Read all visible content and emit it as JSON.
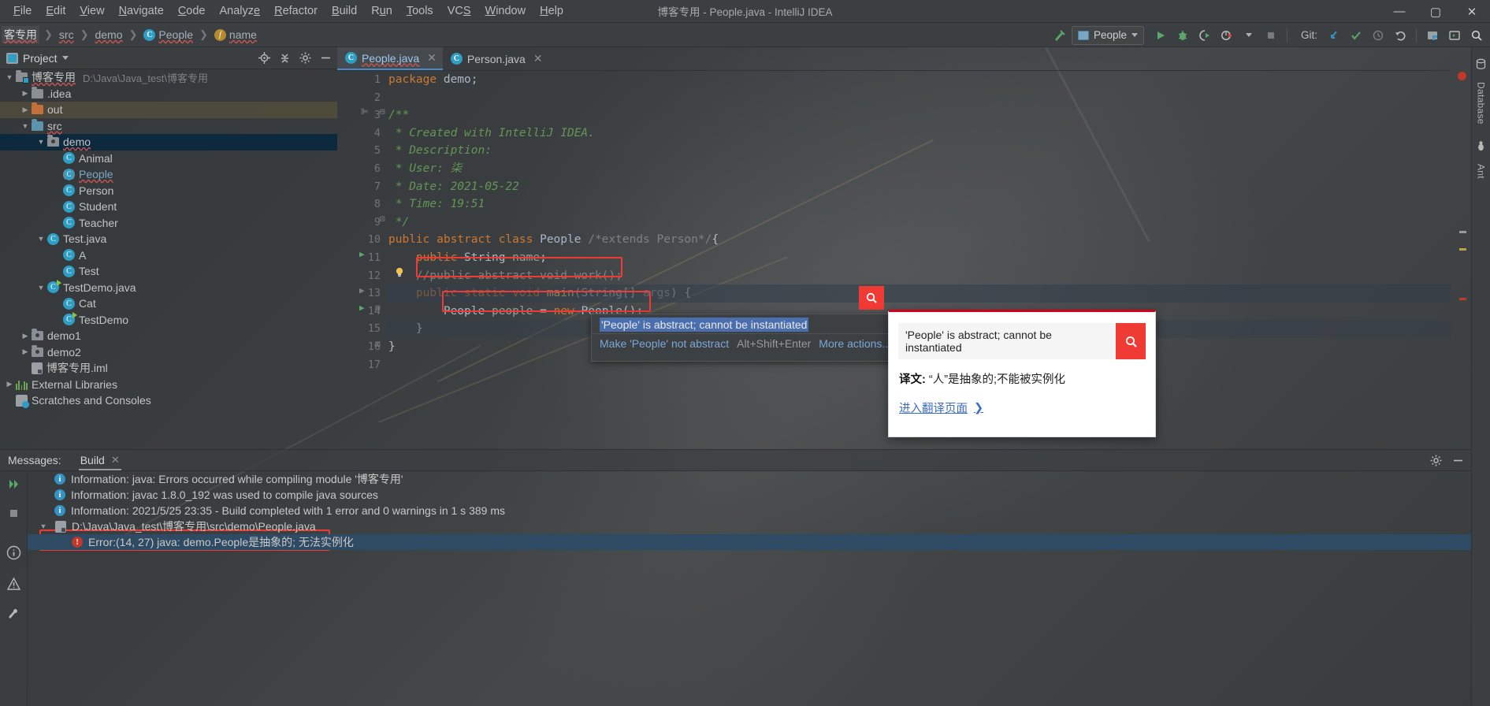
{
  "window": {
    "title": "博客专用 - People.java - IntelliJ IDEA",
    "minimize": "—",
    "maximize": "▢",
    "close": "✕"
  },
  "menubar": {
    "items": [
      "File",
      "Edit",
      "View",
      "Navigate",
      "Code",
      "Analyze",
      "Refactor",
      "Build",
      "Run",
      "Tools",
      "VCS",
      "Window",
      "Help"
    ]
  },
  "breadcrumb": {
    "items": [
      {
        "label": "客专用",
        "icon": ""
      },
      {
        "label": "src",
        "icon": ""
      },
      {
        "label": "demo",
        "icon": ""
      },
      {
        "label": "People",
        "icon": "class-icon",
        "glyph": "C"
      },
      {
        "label": "name",
        "icon": "field-icon",
        "glyph": "f"
      }
    ],
    "separator": "❯"
  },
  "toolbar": {
    "run_config": "People",
    "git_label": "Git:",
    "icons": {
      "build": "hammer-icon",
      "run": "▶",
      "debug": "bug-icon",
      "run_coverage": "coverage-icon",
      "profile": "profiler-icon",
      "stop": "■",
      "update_project": "update-project-icon",
      "commit": "✔",
      "history": "history-icon",
      "rollback": "↺",
      "project_structure": "project-structure-icon",
      "terminal": "terminal-icon",
      "search_everywhere": "search-icon"
    }
  },
  "project_panel": {
    "title": "Project",
    "tools": [
      "locate-icon",
      "collapse-all-icon",
      "settings-icon",
      "hide-icon"
    ],
    "tree": [
      {
        "label": "博客专用",
        "path": "D:\\Java\\Java_test\\博客专用",
        "icon": "module-folder-icon",
        "indent": 0,
        "twist": "▼",
        "state": "normal"
      },
      {
        "label": ".idea",
        "icon": "folder-grey-icon",
        "indent": 1,
        "twist": "▶",
        "state": "normal"
      },
      {
        "label": "out",
        "icon": "folder-orange-icon",
        "indent": 1,
        "twist": "▶",
        "state": "highlight"
      },
      {
        "label": "src",
        "icon": "folder-source-icon",
        "indent": 1,
        "twist": "▼",
        "state": "normal"
      },
      {
        "label": "demo",
        "icon": "package-icon",
        "indent": 2,
        "twist": "▼",
        "state": "selected"
      },
      {
        "label": "Animal",
        "icon": "class-icon",
        "indent": 3,
        "twist": "",
        "state": "normal"
      },
      {
        "label": "People",
        "icon": "abstract-class-icon",
        "indent": 3,
        "twist": "",
        "state": "link"
      },
      {
        "label": "Person",
        "icon": "class-icon",
        "indent": 3,
        "twist": "",
        "state": "normal"
      },
      {
        "label": "Student",
        "icon": "class-icon",
        "indent": 3,
        "twist": "",
        "state": "normal"
      },
      {
        "label": "Teacher",
        "icon": "class-icon",
        "indent": 3,
        "twist": "",
        "state": "normal"
      },
      {
        "label": "Test.java",
        "icon": "class-icon",
        "indent": 2,
        "twist": "▼",
        "state": "normal"
      },
      {
        "label": "A",
        "icon": "class-icon",
        "indent": 3,
        "twist": "",
        "state": "normal"
      },
      {
        "label": "Test",
        "icon": "class-icon",
        "indent": 3,
        "twist": "",
        "state": "normal"
      },
      {
        "label": "TestDemo.java",
        "icon": "runnable-class-icon",
        "indent": 2,
        "twist": "▼",
        "state": "normal"
      },
      {
        "label": "Cat",
        "icon": "class-icon",
        "indent": 3,
        "twist": "",
        "state": "normal"
      },
      {
        "label": "TestDemo",
        "icon": "runnable-class-icon",
        "indent": 3,
        "twist": "",
        "state": "normal"
      },
      {
        "label": "demo1",
        "icon": "package-icon",
        "indent": 1,
        "twist": "▶",
        "state": "normal"
      },
      {
        "label": "demo2",
        "icon": "package-icon",
        "indent": 1,
        "twist": "▶",
        "state": "normal"
      },
      {
        "label": "博客专用.iml",
        "icon": "iml-file-icon",
        "indent": 1,
        "twist": "",
        "state": "normal"
      },
      {
        "label": "External Libraries",
        "icon": "libraries-icon",
        "indent": 0,
        "twist": "▶",
        "state": "normal"
      },
      {
        "label": "Scratches and Consoles",
        "icon": "scratches-icon",
        "indent": 0,
        "twist": "",
        "state": "normal"
      }
    ]
  },
  "editor": {
    "tabs": [
      {
        "label": "People.java",
        "icon": "class-icon",
        "active": true,
        "close": "✕"
      },
      {
        "label": "Person.java",
        "icon": "class-icon",
        "active": false,
        "close": "✕"
      }
    ],
    "line_numbers": [
      "1",
      "2",
      "3",
      "4",
      "5",
      "6",
      "7",
      "8",
      "9",
      "10",
      "11",
      "12",
      "13",
      "14",
      "15",
      "16",
      "17"
    ],
    "lines": [
      "package demo;",
      "",
      "/**",
      " * Created with IntelliJ IDEA.",
      " * Description:",
      " * User: 柒",
      " * Date: 2021-05-22",
      " * Time: 19:51",
      " */",
      "public abstract class People /*extends Person*/{",
      "    public String name;",
      "    //public abstract void work();",
      "    public static void main(String[] args) {",
      "        People people = new People();",
      "    }",
      "}",
      ""
    ]
  },
  "inspection_popup": {
    "message": "'People' is abstract; cannot be instantiated",
    "action": "Make 'People' not abstract",
    "shortcut": "Alt+Shift+Enter",
    "more": "More actions..."
  },
  "translation_popup": {
    "query": "'People' is abstract; cannot be instantiated",
    "search_icon": "search-icon",
    "result_label": "译文:",
    "result_text": "“人”是抽象的;不能被实例化",
    "link": "进入翻译页面",
    "link_arrow": "❯",
    "accent_color": "#f03a34"
  },
  "right_rail": {
    "items": [
      "Database",
      "Ant"
    ]
  },
  "messages_panel": {
    "label": "Messages:",
    "tab": "Build",
    "tab_close": "✕",
    "rows": [
      {
        "icon": "info-icon",
        "text": "Information: java: Errors occurred while compiling module '博客专用'",
        "indent": 1,
        "twist": "",
        "selected": false
      },
      {
        "icon": "info-icon",
        "text": "Information: javac 1.8.0_192 was used to compile java sources",
        "indent": 1,
        "twist": "",
        "selected": false
      },
      {
        "icon": "info-icon",
        "text": "Information: 2021/5/25 23:35 - Build completed with 1 error and 0 warnings in 1 s 389 ms",
        "indent": 1,
        "twist": "",
        "selected": false
      },
      {
        "icon": "file-icon",
        "text": "D:\\Java\\Java_test\\博客专用\\src\\demo\\People.java",
        "indent": 0,
        "twist": "▼",
        "selected": false
      },
      {
        "icon": "error-icon",
        "text": "Error:(14, 27)  java: demo.People是抽象的; 无法实例化",
        "indent": 2,
        "twist": "",
        "selected": true
      }
    ],
    "right_tools": [
      "settings-icon",
      "hide-icon"
    ],
    "rail_icons": [
      "rerun-icon",
      "stop-icon",
      "information-icon",
      "warning-icon"
    ]
  },
  "annotations": {
    "marker_color": "#f03a34",
    "markers": [
      "comment-line-12",
      "new-People-line-14",
      "error-row-highlight"
    ]
  }
}
